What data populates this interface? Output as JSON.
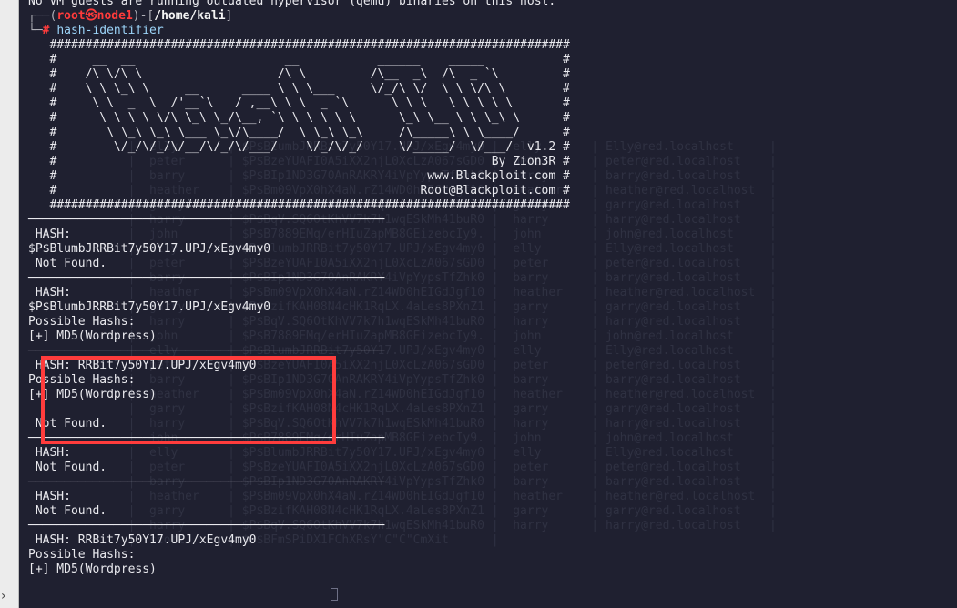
{
  "top_line": "No VM guests are running outdated hypervisor (qemu) binaries on this host.",
  "prompt": {
    "user": "root",
    "at": "㉿",
    "host": "node1",
    "cwd": "/home/kali",
    "symbol": "#",
    "command": "hash-identifier"
  },
  "banner": [
    "   #########################################################################",
    "   #     __  __                     __           ______    _____           #",
    "   #    /\\ \\/\\ \\                   /\\ \\         /\\__  _\\  /\\  _ `\\         #",
    "   #    \\ \\ \\_\\ \\     __      ____ \\ \\ \\___     \\/_/\\ \\/  \\ \\ \\/\\ \\        #",
    "   #     \\ \\  _  \\  /'__`\\   / ,__\\ \\ \\  _ `\\      \\ \\ \\   \\ \\ \\ \\ \\       #",
    "   #      \\ \\ \\ \\ \\/\\ \\_\\ \\_/\\__, `\\ \\ \\ \\ \\ \\      \\_\\ \\__ \\ \\ \\_\\ \\      #",
    "   #       \\ \\_\\ \\_\\ \\___ \\_\\/\\____/  \\ \\_\\ \\_\\     /\\_____\\ \\ \\____/      #",
    "   #        \\/_/\\/_/\\/__/\\/_/\\/___/    \\/_/\\/_/     \\/_____/  \\/___/  v1.2 #",
    "   #                                                             By Zion3R #",
    "   #                                                    www.Blackploit.com #",
    "   #                                                   Root@Blackploit.com #",
    "   #########################################################################"
  ],
  "separator": "──────────────────────────────────────────────────",
  "blocks": [
    {
      "hash_line": " HASH: ",
      "input": "$P$BlumbJRRBit7y50Y17.UPJ/xEgv4my0",
      "result": [
        " Not Found."
      ]
    },
    {
      "hash_line": " HASH: ",
      "input": "$P$BlumbJRRBit7y50Y17.UPJ/xEgv4my0",
      "result": [
        "Possible Hashs:",
        "[+] MD5(Wordpress)"
      ]
    },
    {
      "hash_line": " HASH: RRBit7y50Y17.UPJ/xEgv4my0",
      "result": [
        "Possible Hashs:",
        "[+] MD5(Wordpress)",
        "",
        " Not Found."
      ]
    },
    {
      "hash_line": " HASH:",
      "result": [
        " Not Found."
      ]
    },
    {
      "hash_line": " HASH:",
      "result": [
        " Not Found."
      ]
    },
    {
      "hash_line": " HASH: RRBit7y50Y17.UPJ/xEgv4my0",
      "result": [
        "Possible Hashs:",
        "[+] MD5(Wordpress)"
      ]
    }
  ],
  "colors": {
    "terminal_bg": "#1f2030",
    "text": "#e9e9ee",
    "prompt_red": "#ff3b3b",
    "prompt_blue": "#2e7fe8",
    "command": "#9bd3f7",
    "highlight": "#ff3c3c"
  },
  "icons": [
    "chevron-right-icon",
    "terminal-cursor-icon"
  ]
}
